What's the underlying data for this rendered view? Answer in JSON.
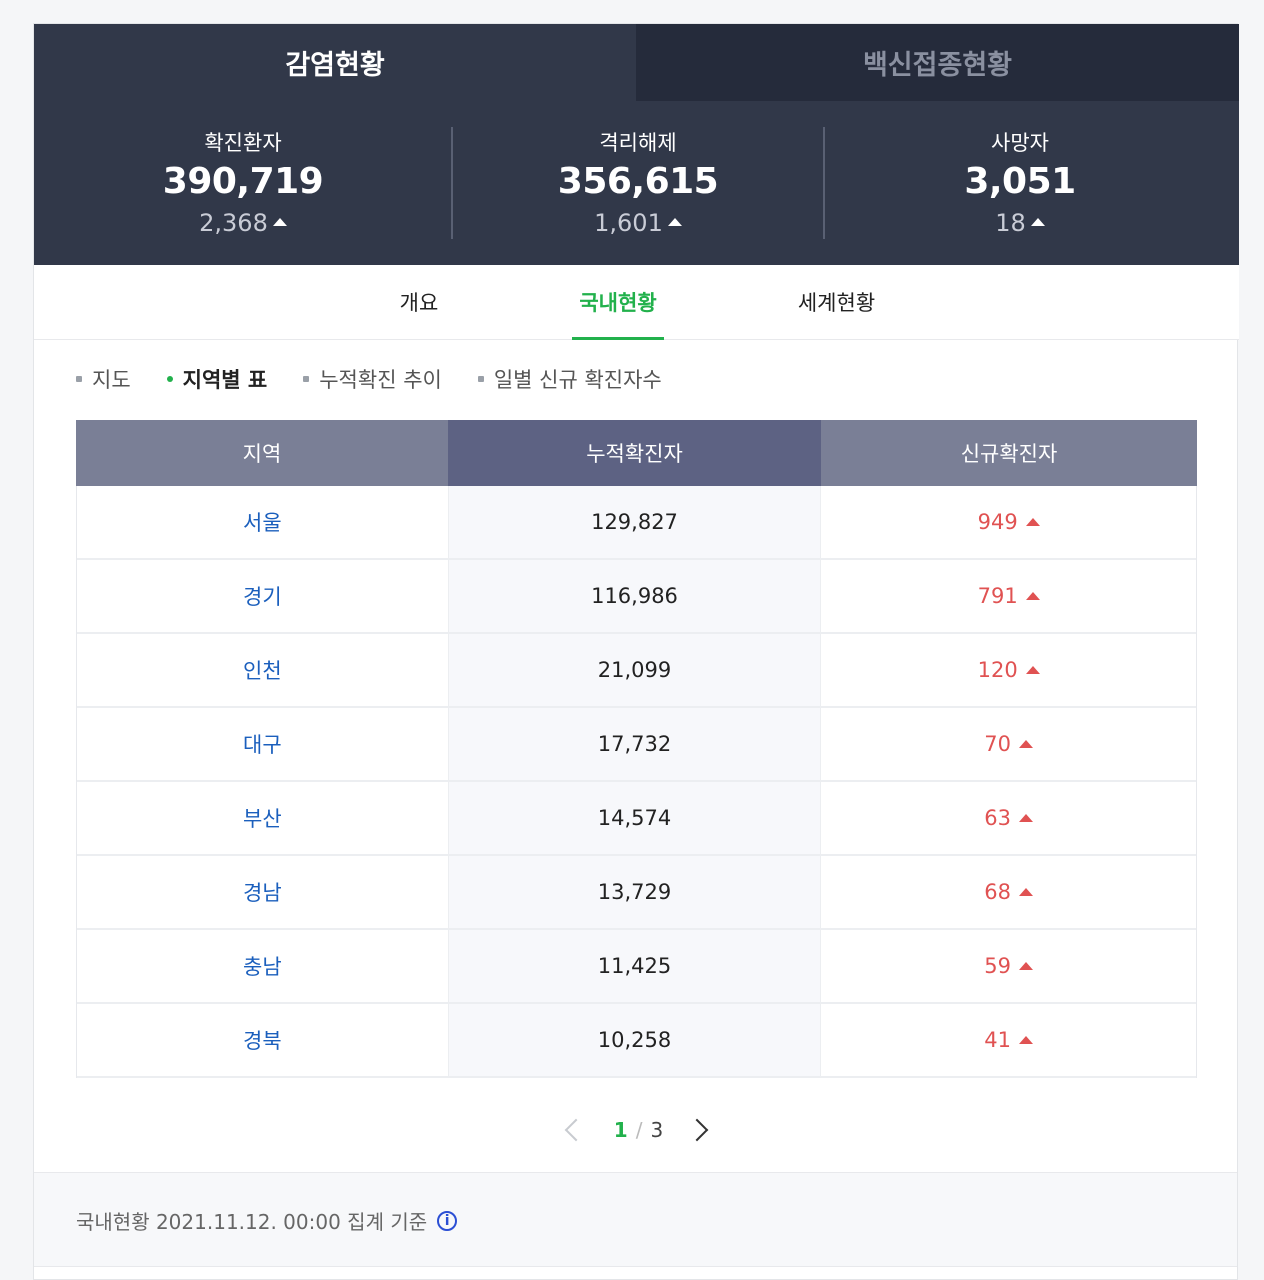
{
  "top_tabs": [
    {
      "label": "감염현황",
      "active": true
    },
    {
      "label": "백신접종현황",
      "active": false
    }
  ],
  "stats": [
    {
      "label": "확진환자",
      "value": "390,719",
      "delta": "2,368"
    },
    {
      "label": "격리해제",
      "value": "356,615",
      "delta": "1,601"
    },
    {
      "label": "사망자",
      "value": "3,051",
      "delta": "18"
    }
  ],
  "subnav": [
    {
      "label": "개요"
    },
    {
      "label": "국내현황",
      "active": true
    },
    {
      "label": "세계현황"
    }
  ],
  "filters": [
    {
      "label": "지도"
    },
    {
      "label": "지역별 표",
      "active": true
    },
    {
      "label": "누적확진 추이"
    },
    {
      "label": "일별 신규 확진자수"
    }
  ],
  "table": {
    "headers": [
      "지역",
      "누적확진자",
      "신규확진자"
    ],
    "rows": [
      {
        "region": "서울",
        "total": "129,827",
        "new": "949"
      },
      {
        "region": "경기",
        "total": "116,986",
        "new": "791"
      },
      {
        "region": "인천",
        "total": "21,099",
        "new": "120"
      },
      {
        "region": "대구",
        "total": "17,732",
        "new": "70"
      },
      {
        "region": "부산",
        "total": "14,574",
        "new": "63"
      },
      {
        "region": "경남",
        "total": "13,729",
        "new": "68"
      },
      {
        "region": "충남",
        "total": "11,425",
        "new": "59"
      },
      {
        "region": "경북",
        "total": "10,258",
        "new": "41"
      }
    ]
  },
  "pager": {
    "current": "1",
    "separator": "/",
    "total": "3"
  },
  "footer": {
    "text": "국내현황 2021.11.12. 00:00 집계 기준",
    "info_icon": "info-icon"
  },
  "colors": {
    "accent": "#22b14c",
    "header_bg": "#313849",
    "increase": "#e05252",
    "region_link": "#1b5fbd"
  }
}
